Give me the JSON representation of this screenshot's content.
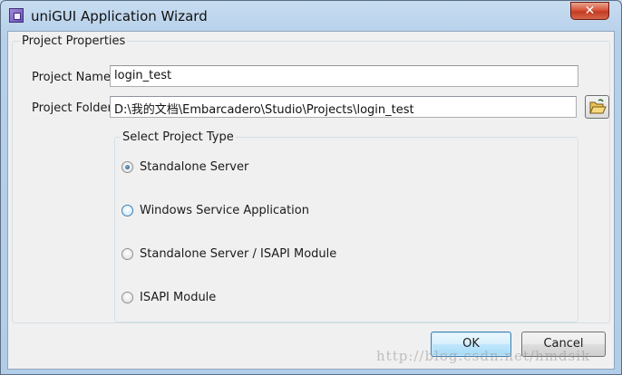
{
  "window": {
    "title": "uniGUI Application Wizard",
    "close_glyph": "✕"
  },
  "project_properties": {
    "legend": "Project Properties",
    "name_label": "Project Name",
    "name_value": "login_test",
    "folder_label": "Project Folder",
    "folder_value": "D:\\我的文档\\Embarcadero\\Studio\\Projects\\login_test",
    "browse_icon": "folder-open-icon"
  },
  "project_type": {
    "legend": "Select Project Type",
    "selected": "Standalone Server",
    "options": [
      {
        "label": "Standalone Server",
        "checked": true
      },
      {
        "label": "Windows Service Application",
        "checked": false
      },
      {
        "label": "Standalone Server / ISAPI Module",
        "checked": false
      },
      {
        "label": "ISAPI Module",
        "checked": false
      }
    ]
  },
  "buttons": {
    "ok": "OK",
    "cancel": "Cancel"
  },
  "watermark": "http://blog.csdn.net/hmdsik",
  "colors": {
    "accent": "#3c7fb1",
    "close": "#c23b21",
    "titlebar": "#b9d1ea"
  }
}
